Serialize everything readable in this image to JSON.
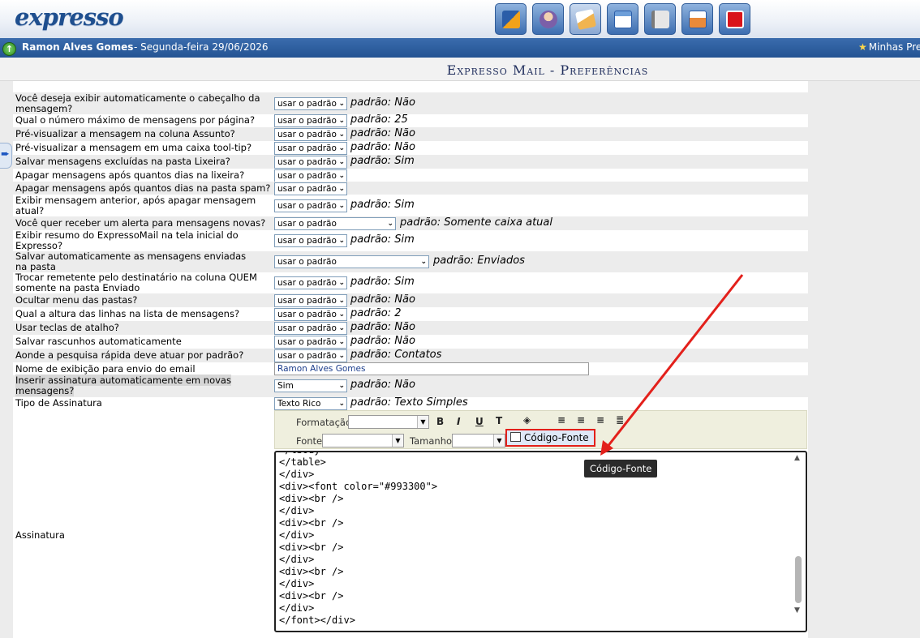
{
  "header": {
    "logo": "expresso",
    "apps": [
      {
        "icon": "calendar-grid-icon",
        "color": "#e88a1a"
      },
      {
        "icon": "contact-person-icon",
        "color": "#c8a27a"
      },
      {
        "icon": "mail-people-icon",
        "color": "#f0b450"
      },
      {
        "icon": "schedule-icon",
        "color": "#6e9fd9"
      },
      {
        "icon": "notebook-icon",
        "color": "#b0b0b0"
      },
      {
        "icon": "config-icon",
        "color": "#e98a3a"
      },
      {
        "icon": "power-icon",
        "color": "#d9141b"
      }
    ]
  },
  "userbar": {
    "username": "Ramon Alves Gomes",
    "date": "- Segunda-feira 29/06/2026",
    "prefs_link": "Minhas Pre"
  },
  "page_title": "Expresso Mail - Preferências",
  "preferences": [
    {
      "question": "Você deseja exibir automaticamente o cabeçalho da mensagem?",
      "select": "usar o padrão",
      "default": "padrão: Não"
    },
    {
      "question": "Qual o número máximo de mensagens por página?",
      "select": "usar o padrão",
      "default": "padrão: 25"
    },
    {
      "question": "Pré-visualizar a mensagem na coluna Assunto?",
      "select": "usar o padrão",
      "default": "padrão: Não"
    },
    {
      "question": "Pré-visualizar a mensagem em uma caixa tool-tip?",
      "select": "usar o padrão",
      "default": "padrão: Não"
    },
    {
      "question": "Salvar mensagens excluídas na pasta Lixeira?",
      "select": "usar o padrão",
      "default": "padrão: Sim"
    },
    {
      "question": "Apagar mensagens após quantos dias na lixeira?",
      "select": "usar o padrão",
      "default": ""
    },
    {
      "question": "Apagar mensagens após quantos dias na pasta spam?",
      "select": "usar o padrão",
      "default": ""
    },
    {
      "question": "Exibir mensagem anterior, após apagar mensagem atual?",
      "select": "usar o padrão",
      "default": "padrão: Sim"
    },
    {
      "question": "Você quer receber um alerta para mensagens novas?",
      "select": "usar o padrão",
      "default": "padrão: Somente caixa atual"
    },
    {
      "question": "Exibir resumo do ExpressoMail na tela inicial do Expresso?",
      "select": "usar o padrão",
      "default": "padrão: Sim"
    },
    {
      "question": "Salvar automaticamente as mensagens enviadas na pasta",
      "select": "usar o padrão",
      "default": "padrão: Enviados"
    },
    {
      "question": "Trocar remetente pelo destinatário na coluna QUEM somente na pasta Enviado",
      "select": "usar o padrão",
      "default": "padrão: Sim"
    },
    {
      "question": "Ocultar menu das pastas?",
      "select": "usar o padrão",
      "default": "padrão: Não"
    },
    {
      "question": "Qual a altura das linhas na lista de mensagens?",
      "select": "usar o padrão",
      "default": "padrão: 2"
    },
    {
      "question": "Usar teclas de atalho?",
      "select": "usar o padrão",
      "default": "padrão: Não"
    },
    {
      "question": "Salvar rascunhos automaticamente",
      "select": "usar o padrão",
      "default": "padrão: Não"
    },
    {
      "question": "Aonde a pesquisa rápida deve atuar por padrão?",
      "select": "usar o padrão",
      "default": "padrão: Contatos"
    },
    {
      "question": "Nome de exibição para envio do email",
      "value": "Ramon Alves Gomes"
    },
    {
      "question": "Inserir assinatura automaticamente em novas mensagens?",
      "select": "Sim",
      "default": "padrão: Não"
    },
    {
      "question": "Tipo de Assinatura",
      "select": "Texto Rico",
      "default": "padrão: Texto Simples"
    }
  ],
  "signature": {
    "label": "Assinatura",
    "toolbar": {
      "format_label": "Formatação",
      "font_label": "Fonte",
      "size_label": "Tamanho",
      "bold": "B",
      "italic": "I",
      "underline": "U",
      "text_color": "T",
      "source_button": "Código-Fonte"
    },
    "code_lines": [
      "</tbody>",
      "</table>",
      "</div>",
      "<div><font color=\"#993300\">",
      "<div><br />",
      "</div>",
      "<div><br />",
      "</div>",
      "<div><br />",
      "</div>",
      "<div><br />",
      "</div>",
      "<div><br />",
      "</div>",
      "</font></div>"
    ],
    "tooltip": "Código-Fonte"
  },
  "colors": {
    "accent": "#245493",
    "highlight_border": "#e3201b",
    "annotation_arrow": "#e3201b"
  }
}
